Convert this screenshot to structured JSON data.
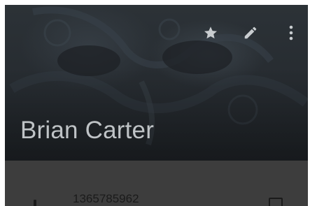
{
  "contact": {
    "name": "Brian Carter"
  },
  "header": {
    "actions": [
      {
        "icon": "star-icon"
      },
      {
        "icon": "edit-pencil-icon"
      },
      {
        "icon": "more-vert-icon"
      }
    ]
  },
  "phones": [
    {
      "number": "1365785962",
      "icon": "phone-icon",
      "action_icon": "message-icon"
    }
  ],
  "colors": {
    "header_bg": "#262b30",
    "name_text": "#bfc3c6",
    "icon": "#c9cdd0",
    "details_bg": "#3d3d3d",
    "number_text": "#1b1b1b"
  }
}
